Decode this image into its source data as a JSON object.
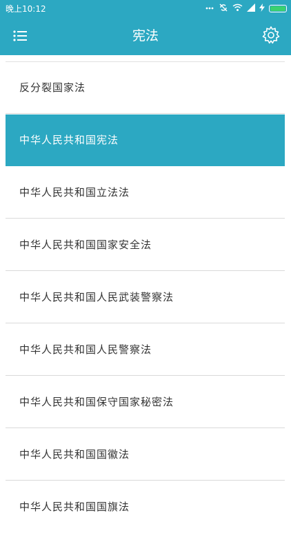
{
  "status": {
    "time": "晚上10:12"
  },
  "appbar": {
    "title": "宪法"
  },
  "icons": {
    "menu": "list-menu-icon",
    "settings": "gear-icon"
  },
  "colors": {
    "accent": "#2ca8c2",
    "selected_text": "#ffffff",
    "text": "#333333",
    "divider": "#d9d9d9"
  },
  "list": {
    "items": [
      {
        "label": "反分裂国家法",
        "selected": false
      },
      {
        "label": "中华人民共和国宪法",
        "selected": true
      },
      {
        "label": "中华人民共和国立法法",
        "selected": false
      },
      {
        "label": "中华人民共和国国家安全法",
        "selected": false
      },
      {
        "label": "中华人民共和国人民武装警察法",
        "selected": false
      },
      {
        "label": "中华人民共和国人民警察法",
        "selected": false
      },
      {
        "label": "中华人民共和国保守国家秘密法",
        "selected": false
      },
      {
        "label": "中华人民共和国国徽法",
        "selected": false
      },
      {
        "label": "中华人民共和国国旗法",
        "selected": false
      }
    ]
  }
}
